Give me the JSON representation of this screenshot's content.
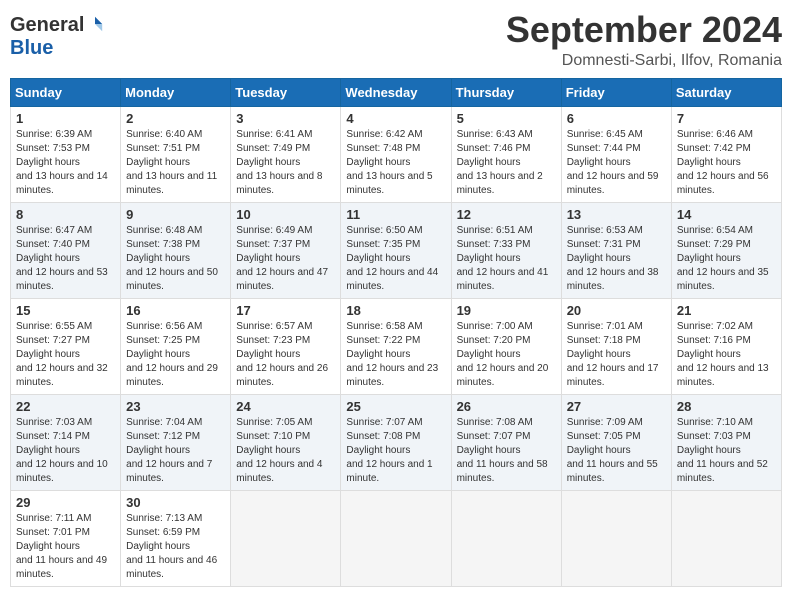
{
  "logo": {
    "general": "General",
    "blue": "Blue"
  },
  "title": "September 2024",
  "location": "Domnesti-Sarbi, Ilfov, Romania",
  "weekdays": [
    "Sunday",
    "Monday",
    "Tuesday",
    "Wednesday",
    "Thursday",
    "Friday",
    "Saturday"
  ],
  "weeks": [
    [
      {
        "day": 1,
        "sunrise": "6:39 AM",
        "sunset": "7:53 PM",
        "daylight": "13 hours and 14 minutes."
      },
      {
        "day": 2,
        "sunrise": "6:40 AM",
        "sunset": "7:51 PM",
        "daylight": "13 hours and 11 minutes."
      },
      {
        "day": 3,
        "sunrise": "6:41 AM",
        "sunset": "7:49 PM",
        "daylight": "13 hours and 8 minutes."
      },
      {
        "day": 4,
        "sunrise": "6:42 AM",
        "sunset": "7:48 PM",
        "daylight": "13 hours and 5 minutes."
      },
      {
        "day": 5,
        "sunrise": "6:43 AM",
        "sunset": "7:46 PM",
        "daylight": "13 hours and 2 minutes."
      },
      {
        "day": 6,
        "sunrise": "6:45 AM",
        "sunset": "7:44 PM",
        "daylight": "12 hours and 59 minutes."
      },
      {
        "day": 7,
        "sunrise": "6:46 AM",
        "sunset": "7:42 PM",
        "daylight": "12 hours and 56 minutes."
      }
    ],
    [
      {
        "day": 8,
        "sunrise": "6:47 AM",
        "sunset": "7:40 PM",
        "daylight": "12 hours and 53 minutes."
      },
      {
        "day": 9,
        "sunrise": "6:48 AM",
        "sunset": "7:38 PM",
        "daylight": "12 hours and 50 minutes."
      },
      {
        "day": 10,
        "sunrise": "6:49 AM",
        "sunset": "7:37 PM",
        "daylight": "12 hours and 47 minutes."
      },
      {
        "day": 11,
        "sunrise": "6:50 AM",
        "sunset": "7:35 PM",
        "daylight": "12 hours and 44 minutes."
      },
      {
        "day": 12,
        "sunrise": "6:51 AM",
        "sunset": "7:33 PM",
        "daylight": "12 hours and 41 minutes."
      },
      {
        "day": 13,
        "sunrise": "6:53 AM",
        "sunset": "7:31 PM",
        "daylight": "12 hours and 38 minutes."
      },
      {
        "day": 14,
        "sunrise": "6:54 AM",
        "sunset": "7:29 PM",
        "daylight": "12 hours and 35 minutes."
      }
    ],
    [
      {
        "day": 15,
        "sunrise": "6:55 AM",
        "sunset": "7:27 PM",
        "daylight": "12 hours and 32 minutes."
      },
      {
        "day": 16,
        "sunrise": "6:56 AM",
        "sunset": "7:25 PM",
        "daylight": "12 hours and 29 minutes."
      },
      {
        "day": 17,
        "sunrise": "6:57 AM",
        "sunset": "7:23 PM",
        "daylight": "12 hours and 26 minutes."
      },
      {
        "day": 18,
        "sunrise": "6:58 AM",
        "sunset": "7:22 PM",
        "daylight": "12 hours and 23 minutes."
      },
      {
        "day": 19,
        "sunrise": "7:00 AM",
        "sunset": "7:20 PM",
        "daylight": "12 hours and 20 minutes."
      },
      {
        "day": 20,
        "sunrise": "7:01 AM",
        "sunset": "7:18 PM",
        "daylight": "12 hours and 17 minutes."
      },
      {
        "day": 21,
        "sunrise": "7:02 AM",
        "sunset": "7:16 PM",
        "daylight": "12 hours and 13 minutes."
      }
    ],
    [
      {
        "day": 22,
        "sunrise": "7:03 AM",
        "sunset": "7:14 PM",
        "daylight": "12 hours and 10 minutes."
      },
      {
        "day": 23,
        "sunrise": "7:04 AM",
        "sunset": "7:12 PM",
        "daylight": "12 hours and 7 minutes."
      },
      {
        "day": 24,
        "sunrise": "7:05 AM",
        "sunset": "7:10 PM",
        "daylight": "12 hours and 4 minutes."
      },
      {
        "day": 25,
        "sunrise": "7:07 AM",
        "sunset": "7:08 PM",
        "daylight": "12 hours and 1 minute."
      },
      {
        "day": 26,
        "sunrise": "7:08 AM",
        "sunset": "7:07 PM",
        "daylight": "11 hours and 58 minutes."
      },
      {
        "day": 27,
        "sunrise": "7:09 AM",
        "sunset": "7:05 PM",
        "daylight": "11 hours and 55 minutes."
      },
      {
        "day": 28,
        "sunrise": "7:10 AM",
        "sunset": "7:03 PM",
        "daylight": "11 hours and 52 minutes."
      }
    ],
    [
      {
        "day": 29,
        "sunrise": "7:11 AM",
        "sunset": "7:01 PM",
        "daylight": "11 hours and 49 minutes."
      },
      {
        "day": 30,
        "sunrise": "7:13 AM",
        "sunset": "6:59 PM",
        "daylight": "11 hours and 46 minutes."
      },
      null,
      null,
      null,
      null,
      null
    ]
  ],
  "labels": {
    "sunrise": "Sunrise:",
    "sunset": "Sunset:",
    "daylight": "Daylight hours"
  }
}
